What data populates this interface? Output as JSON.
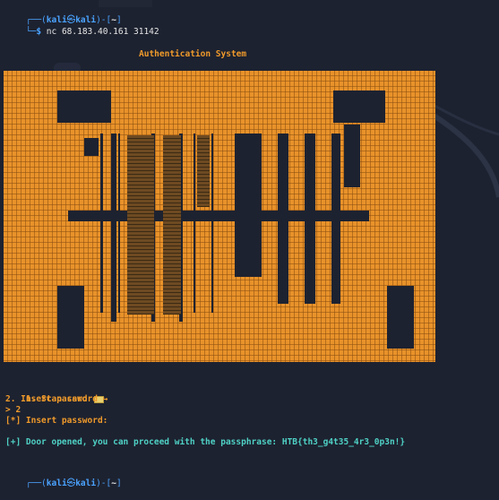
{
  "terminal": {
    "prompt_prefix": "┌──(",
    "user": "kali",
    "at": "㉿",
    "host": "kali",
    "path_open": ")-[",
    "path": "~",
    "path_close": "]",
    "prompt_symbol_prefix": "└─",
    "prompt_symbol": "$",
    "command": " nc 68.183.40.161 31142",
    "header": "Authentication System",
    "menu": [
      {
        "text": "1. Scan card ",
        "icon": "card-icon"
      },
      {
        "text": "2. Insert password ↪"
      }
    ],
    "input_line": "> 2",
    "status": "[*] Insert password:",
    "success": "[+] Door opened, you can proceed with the passphrase: HTB{th3_g4t35_4r3_0p3n!}",
    "final_prompt_prefix": "┌──(",
    "final_user": "kali",
    "final_at": "㉿",
    "final_host": "kali",
    "final_path_open": ")-[",
    "final_path": "~",
    "final_path_close": "]"
  },
  "colors": {
    "background": "#1d2230",
    "gate": "#e8922a",
    "gate_dark": "#8a4f10",
    "gate_stripe": "#6e4a22",
    "prompt_blue": "#4aa3ff",
    "orange_text": "#ef9a2b",
    "cyan_text": "#4fd1c5"
  }
}
